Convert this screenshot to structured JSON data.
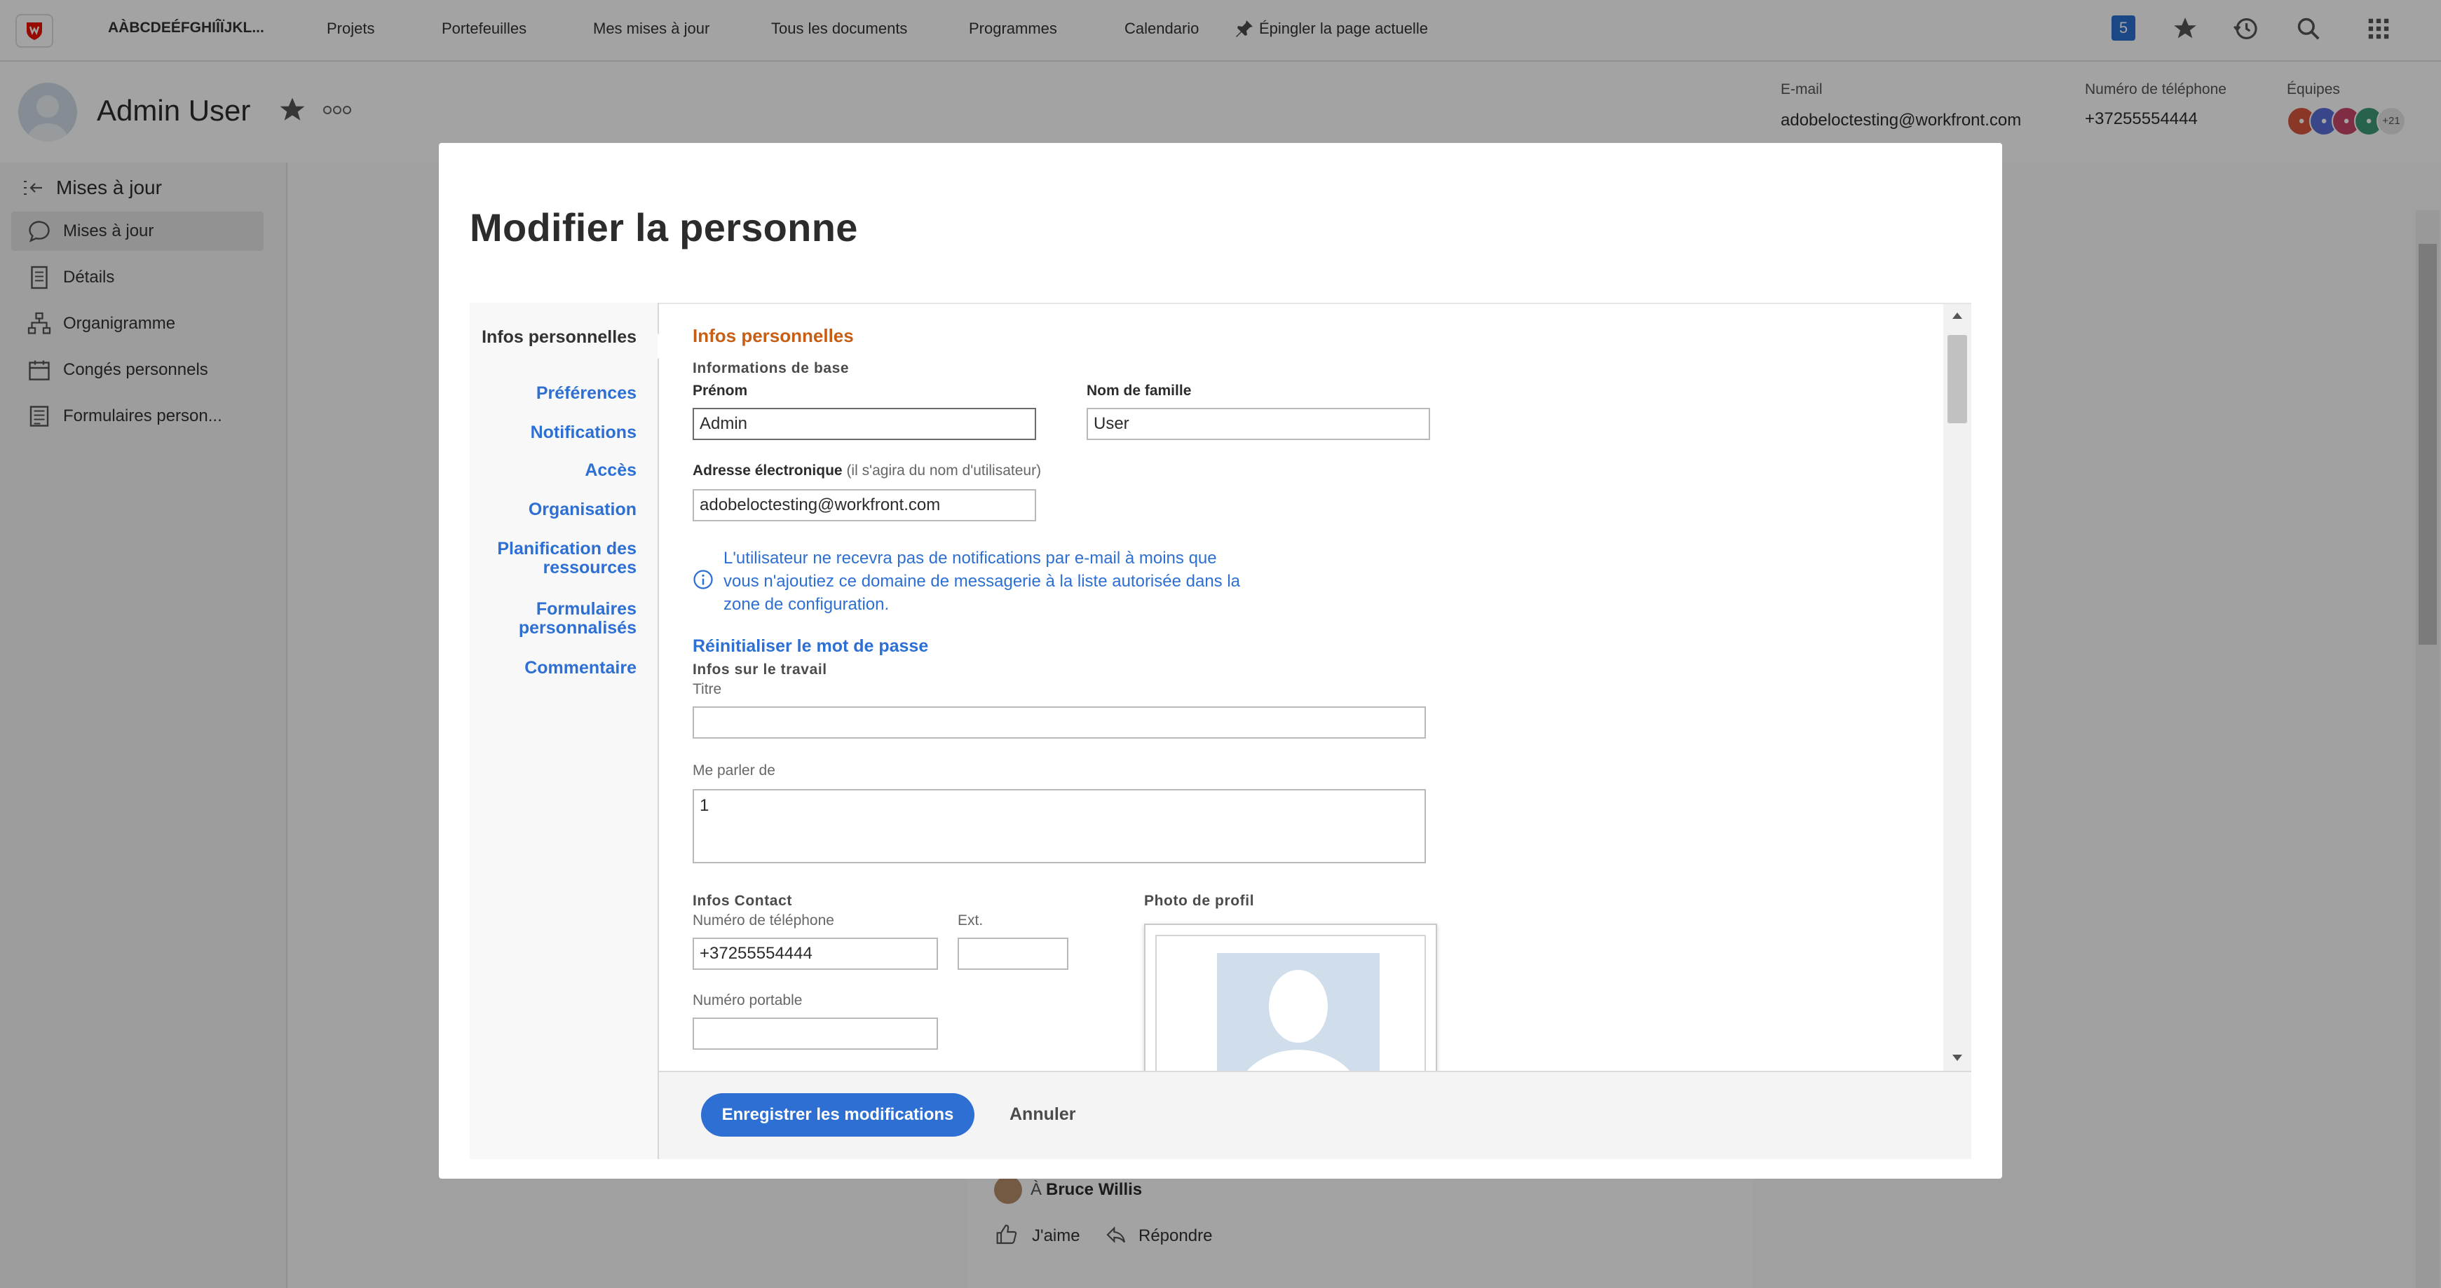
{
  "topnav": {
    "workspace": "AÀBCDEÉFGHIÎÏJKL...",
    "items": [
      "Projets",
      "Portefeuilles",
      "Mes mises à jour",
      "Tous les documents",
      "Programmes",
      "Calendario"
    ],
    "pin_label": "Épingler la page actuelle",
    "notification_count": "5"
  },
  "header": {
    "name": "Admin User",
    "email_label": "E-mail",
    "email": "adobeloctesting@workfront.com",
    "phone_label": "Numéro de téléphone",
    "phone": "+37255554444",
    "teams_label": "Équipes",
    "teams_more": "+21"
  },
  "sidebar": {
    "back_label": "Mises à jour",
    "items": [
      {
        "label": "Mises à jour",
        "icon": "comment-icon"
      },
      {
        "label": "Détails",
        "icon": "document-icon"
      },
      {
        "label": "Organigramme",
        "icon": "org-chart-icon"
      },
      {
        "label": "Congés personnels",
        "icon": "calendar-icon"
      },
      {
        "label": "Formulaires person...",
        "icon": "form-icon"
      }
    ]
  },
  "background_feed": {
    "recipient_prefix": "À",
    "recipient": "Bruce Willis",
    "like_label": "J'aime",
    "reply_label": "Répondre"
  },
  "modal": {
    "title": "Modifier la personne",
    "nav": [
      "Infos personnelles",
      "Préférences",
      "Notifications",
      "Accès",
      "Organisation",
      "Planification des ressources",
      "Formulaires personnalisés",
      "Commentaire"
    ],
    "section_title": "Infos personnelles",
    "basic_info": "Informations de base",
    "first_name_label": "Prénom",
    "first_name": "Admin",
    "last_name_label": "Nom de famille",
    "last_name": "User",
    "email_label": "Adresse électronique",
    "email_hint": "(il s'agira du nom d'utilisateur)",
    "email": "adobeloctesting@workfront.com",
    "info_message": "L'utilisateur ne recevra pas de notifications par e-mail à moins que vous n'ajoutiez ce domaine de messagerie à la liste autorisée dans la zone de configuration.",
    "reset_password": "Réinitialiser le mot de passe",
    "work_info": "Infos sur le travail",
    "title_label": "Titre",
    "title_value": "",
    "about_label": "Me parler de",
    "about_value": "1",
    "contact_info": "Infos Contact",
    "phone_label": "Numéro de téléphone",
    "phone": "+37255554444",
    "ext_label": "Ext.",
    "ext": "",
    "mobile_label": "Numéro portable",
    "mobile": "",
    "photo_label": "Photo de profil",
    "save_label": "Enregistrer les modifications",
    "cancel_label": "Annuler"
  },
  "colors": {
    "accent": "#2d6fd3",
    "section": "#c85e14",
    "brand": "#eb1000"
  }
}
